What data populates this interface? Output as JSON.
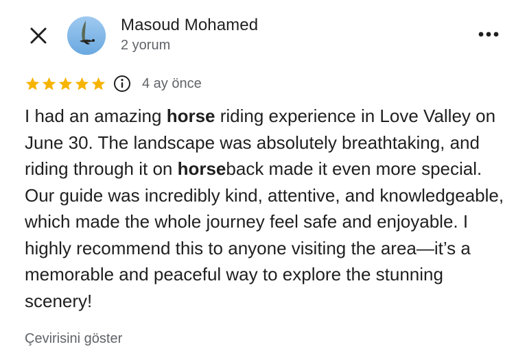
{
  "header": {
    "close_icon": "close-icon",
    "author_name": "Masoud Mohamed",
    "review_count": "2 yorum",
    "more_icon": "more-options-icon"
  },
  "rating": {
    "stars": 5,
    "max_stars": 5,
    "star_color": "#f6b400",
    "info_icon": "info-icon",
    "time_ago": "4 ay önce"
  },
  "review": {
    "segments": [
      "I had an amazing ",
      "horse",
      " riding experience in Love Valley on June 30. The landscape was absolutely breathtaking, and riding through it on ",
      "horse",
      "back made it even more special. Our guide was incredibly kind, attentive, and knowledgeable, which made the whole journey feel safe and enjoyable. I highly recommend this to anyone visiting the area—it’s a memorable and peaceful way to explore the stunning scenery!"
    ]
  },
  "footer": {
    "translate_label": "Çevirisini göster"
  }
}
